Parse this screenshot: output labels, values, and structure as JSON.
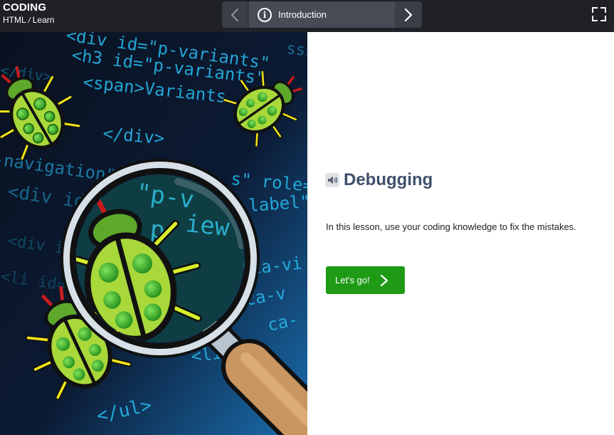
{
  "header": {
    "app_title": "CODING",
    "breadcrumb": {
      "course": "HTML",
      "separator": "/",
      "section": "Learn"
    },
    "lesson_nav": {
      "current": "Introduction",
      "prev_icon": "chevron-left-icon",
      "next_icon": "chevron-right-icon",
      "info_icon": "info-circle-icon"
    },
    "fullscreen_icon": "fullscreen-icon"
  },
  "illustration": {
    "code_text": [
      "<div id=\"p-variants\"",
      "<h3 id=\"p-variants\"",
      "<span>Variants",
      "</div>",
      "-navigation\">",
      "<div id=\"p-v",
      "s\" role=",
      "label\"",
      "iew",
      "id=\"ca-vi",
      "ca-v",
      "</ul>",
      "<li",
      "ca-"
    ]
  },
  "lesson": {
    "audio_icon": "speaker-icon",
    "title": "Debugging",
    "description": "In this lesson, use your coding knowledge to fix the mistakes.",
    "cta_label": "Let's go!"
  },
  "colors": {
    "topbar": "#1f2127",
    "heading": "#40506b",
    "cta": "#1f9a15",
    "code": "#26b6e8"
  }
}
